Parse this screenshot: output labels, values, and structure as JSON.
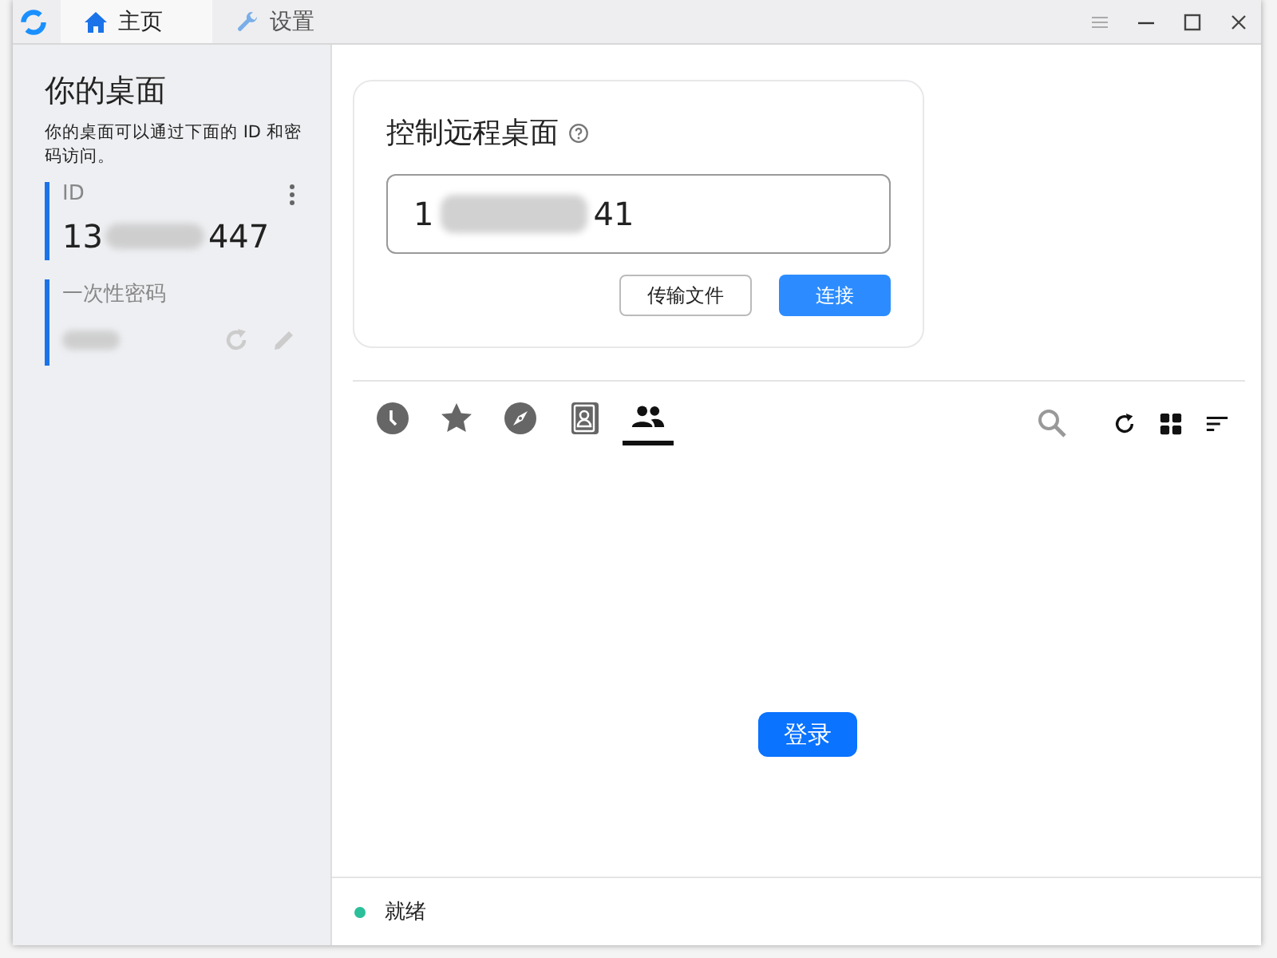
{
  "tabs": [
    {
      "kind": "home",
      "label": "主页",
      "selected": true
    },
    {
      "kind": "settings",
      "label": "设置",
      "selected": false
    }
  ],
  "sidebar": {
    "title": "你的桌面",
    "description": "你的桌面可以通过下面的 ID 和密码访问。",
    "id_label": "ID",
    "id_start": "13",
    "id_end": "447",
    "password_label": "一次性密码"
  },
  "connect": {
    "title": "控制远程桌面",
    "id_start": "1",
    "id_end": "41",
    "buttons": [
      {
        "kind": "secondary",
        "label": "传输文件"
      },
      {
        "kind": "primary",
        "label": "连接"
      }
    ]
  },
  "peer_tabs": [
    {
      "kind": "recent",
      "selected": false
    },
    {
      "kind": "favorites",
      "selected": false
    },
    {
      "kind": "discovered",
      "selected": false
    },
    {
      "kind": "address-book",
      "selected": false
    },
    {
      "kind": "group",
      "selected": true
    }
  ],
  "login_button": "登录",
  "status": {
    "text": "就绪",
    "color": "#2bbf9a"
  }
}
